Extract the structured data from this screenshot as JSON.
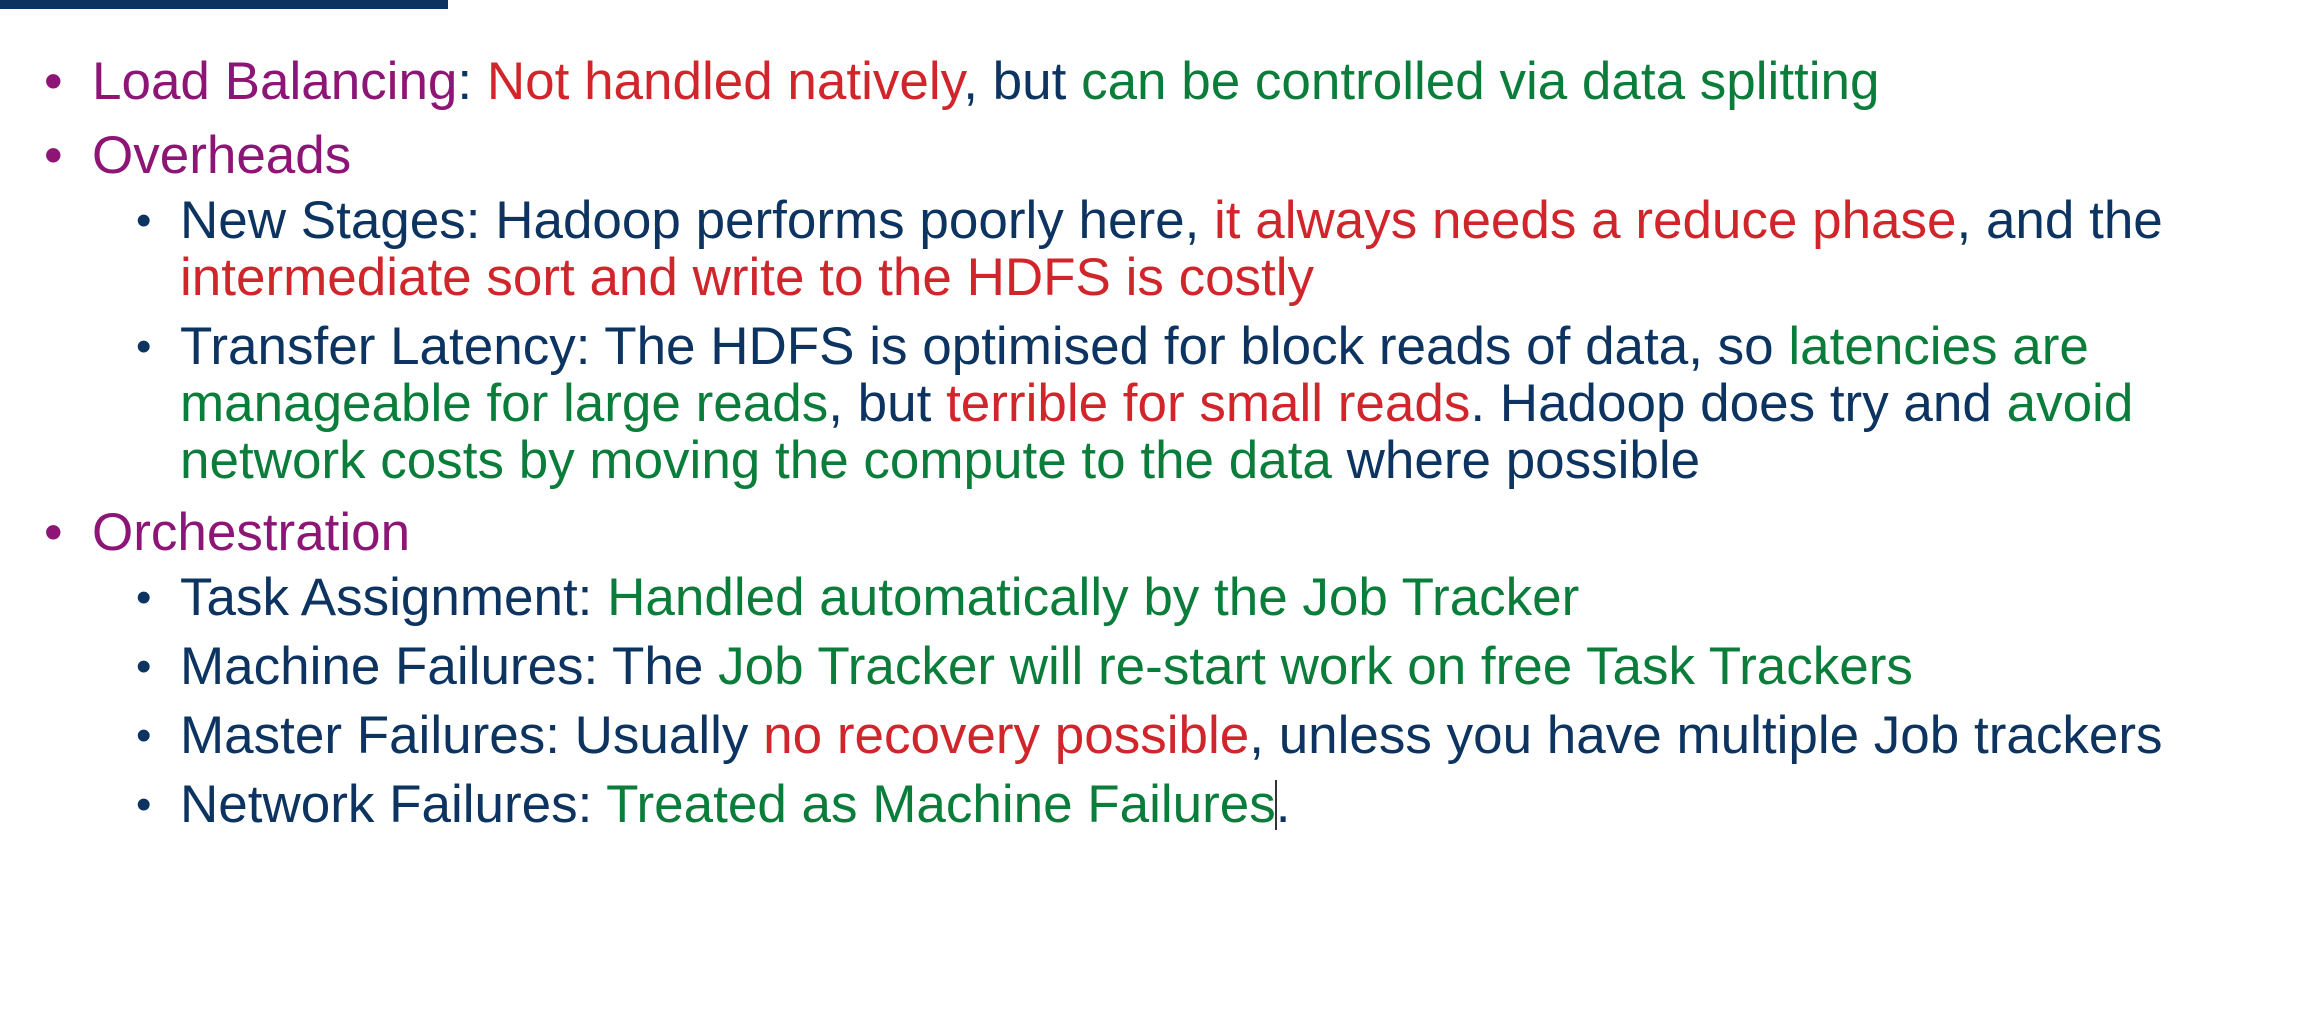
{
  "accent_colors": {
    "bar": "#0d3461",
    "heading": "#8d1576",
    "body": "#0d3461",
    "negative": "#d0262b",
    "positive": "#0b7d3a"
  },
  "sections": [
    {
      "segments": [
        {
          "text": "Load Balancing",
          "color": "purple"
        },
        {
          "text": ": ",
          "color": "navy"
        },
        {
          "text": "Not handled natively",
          "color": "red"
        },
        {
          "text": ", but ",
          "color": "navy"
        },
        {
          "text": "can be controlled via data splitting",
          "color": "green"
        }
      ],
      "items": []
    },
    {
      "segments": [
        {
          "text": "Overheads",
          "color": "purple"
        }
      ],
      "items": [
        {
          "segments": [
            {
              "text": "New Stages: Hadoop performs poorly here, ",
              "color": "navy"
            },
            {
              "text": "it always needs a reduce phase",
              "color": "red"
            },
            {
              "text": ", and the ",
              "color": "navy"
            },
            {
              "text": "intermediate sort and write to the HDFS is costly",
              "color": "red"
            }
          ]
        },
        {
          "segments": [
            {
              "text": "Transfer Latency: The HDFS is optimised for block reads of data, so ",
              "color": "navy"
            },
            {
              "text": "latencies are manageable for large reads",
              "color": "green"
            },
            {
              "text": ", but ",
              "color": "navy"
            },
            {
              "text": "terrible for small reads",
              "color": "red"
            },
            {
              "text": ". Hadoop does try and ",
              "color": "navy"
            },
            {
              "text": "avoid network costs by moving the compute to the data",
              "color": "green"
            },
            {
              "text": " where possible",
              "color": "navy"
            }
          ]
        }
      ]
    },
    {
      "segments": [
        {
          "text": "Orchestration",
          "color": "purple"
        }
      ],
      "items": [
        {
          "segments": [
            {
              "text": "Task Assignment: ",
              "color": "navy"
            },
            {
              "text": "Handled automatically by the Job Tracker",
              "color": "green"
            }
          ]
        },
        {
          "segments": [
            {
              "text": "Machine Failures: The ",
              "color": "navy"
            },
            {
              "text": "Job Tracker will re-start work on free Task Trackers",
              "color": "green"
            }
          ]
        },
        {
          "segments": [
            {
              "text": "Master Failures: Usually ",
              "color": "navy"
            },
            {
              "text": "no recovery possible",
              "color": "red"
            },
            {
              "text": ", unless you have multiple Job trackers",
              "color": "navy"
            }
          ]
        },
        {
          "segments": [
            {
              "text": "Network Failures: ",
              "color": "navy"
            },
            {
              "text": "Treated as Machine Failures",
              "color": "green"
            },
            {
              "text": ".",
              "color": "navy"
            }
          ]
        }
      ]
    }
  ]
}
